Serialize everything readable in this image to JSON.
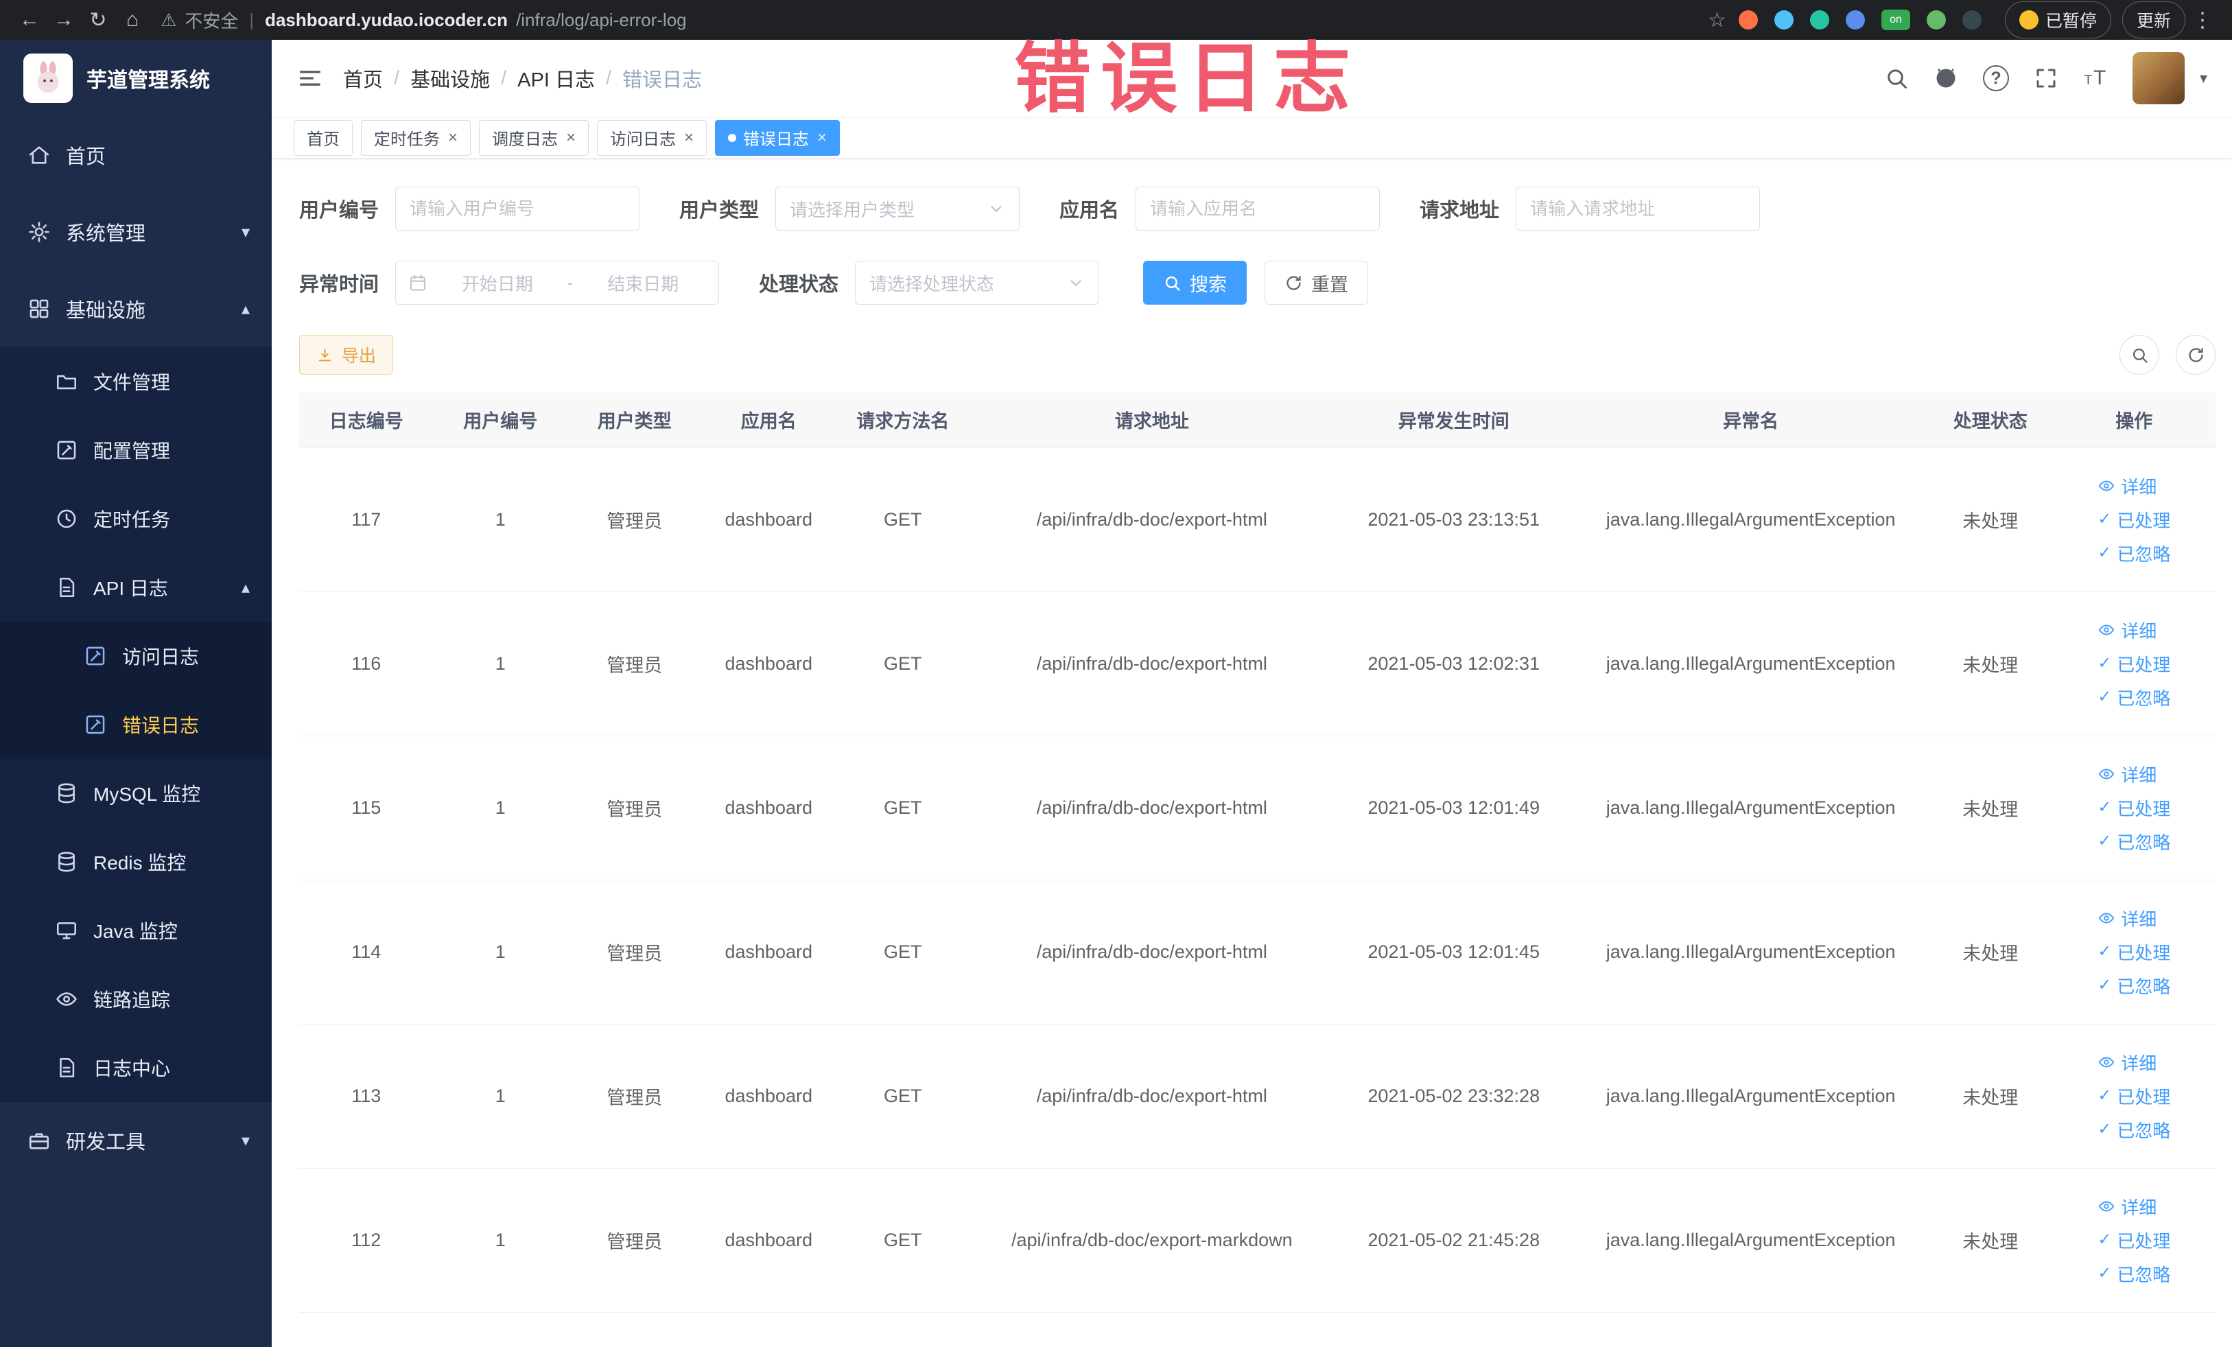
{
  "browser": {
    "security_label": "不安全",
    "url_host": "dashboard.yudao.iocoder.cn",
    "url_path": "/infra/log/api-error-log",
    "on_badge": "on",
    "paused_label": "已暂停",
    "update_label": "更新"
  },
  "annotation": {
    "text": "错误日志"
  },
  "sidebar": {
    "title": "芋道管理系统",
    "items": [
      {
        "id": "home",
        "label": "首页",
        "icon": "home-icon",
        "level": 0
      },
      {
        "id": "system-management",
        "label": "系统管理",
        "icon": "gear-icon",
        "level": 0,
        "chevron": "down"
      },
      {
        "id": "infrastructure",
        "label": "基础设施",
        "icon": "grid-icon",
        "level": 0,
        "chevron": "up"
      },
      {
        "id": "file-management",
        "label": "文件管理",
        "icon": "folder-icon",
        "level": 1
      },
      {
        "id": "config-management",
        "label": "配置管理",
        "icon": "edit-icon",
        "level": 1
      },
      {
        "id": "scheduled-tasks",
        "label": "定时任务",
        "icon": "clock-icon",
        "level": 1
      },
      {
        "id": "api-logs",
        "label": "API 日志",
        "icon": "doc-icon",
        "level": 1,
        "chevron": "up"
      },
      {
        "id": "access-logs",
        "label": "访问日志",
        "icon": "edit-icon",
        "level": 2
      },
      {
        "id": "error-logs",
        "label": "错误日志",
        "icon": "edit-icon",
        "level": 2,
        "active": true
      },
      {
        "id": "mysql-monitor",
        "label": "MySQL 监控",
        "icon": "database-icon",
        "level": 1
      },
      {
        "id": "redis-monitor",
        "label": "Redis 监控",
        "icon": "database-icon",
        "level": 1
      },
      {
        "id": "java-monitor",
        "label": "Java 监控",
        "icon": "monitor-icon",
        "level": 1
      },
      {
        "id": "tracing",
        "label": "链路追踪",
        "icon": "eye-icon",
        "level": 1
      },
      {
        "id": "log-center",
        "label": "日志中心",
        "icon": "doc-icon",
        "level": 1
      },
      {
        "id": "dev-tools",
        "label": "研发工具",
        "icon": "briefcase-icon",
        "level": 0,
        "chevron": "down"
      }
    ]
  },
  "header": {
    "breadcrumb": [
      "首页",
      "基础设施",
      "API 日志",
      "错误日志"
    ]
  },
  "tabs": [
    {
      "label": "首页",
      "closable": false,
      "active": false
    },
    {
      "label": "定时任务",
      "closable": true,
      "active": false
    },
    {
      "label": "调度日志",
      "closable": true,
      "active": false
    },
    {
      "label": "访问日志",
      "closable": true,
      "active": false
    },
    {
      "label": "错误日志",
      "closable": true,
      "active": true
    }
  ],
  "filters": {
    "user_id": {
      "label": "用户编号",
      "placeholder": "请输入用户编号"
    },
    "user_type": {
      "label": "用户类型",
      "placeholder": "请选择用户类型"
    },
    "app_name": {
      "label": "应用名",
      "placeholder": "请输入应用名"
    },
    "request_url": {
      "label": "请求地址",
      "placeholder": "请输入请求地址"
    },
    "exception_time": {
      "label": "异常时间",
      "start_placeholder": "开始日期",
      "separator": "-",
      "end_placeholder": "结束日期"
    },
    "process_status": {
      "label": "处理状态",
      "placeholder": "请选择处理状态"
    },
    "search_label": "搜索",
    "reset_label": "重置"
  },
  "toolbar": {
    "export_label": "导出"
  },
  "table": {
    "columns": [
      "日志编号",
      "用户编号",
      "用户类型",
      "应用名",
      "请求方法名",
      "请求地址",
      "异常发生时间",
      "异常名",
      "处理状态",
      "操作"
    ],
    "rows": [
      [
        "117",
        "1",
        "管理员",
        "dashboard",
        "GET",
        "/api/infra/db-doc/export-html",
        "2021-05-03 23:13:51",
        "java.lang.IllegalArgumentException",
        "未处理"
      ],
      [
        "116",
        "1",
        "管理员",
        "dashboard",
        "GET",
        "/api/infra/db-doc/export-html",
        "2021-05-03 12:02:31",
        "java.lang.IllegalArgumentException",
        "未处理"
      ],
      [
        "115",
        "1",
        "管理员",
        "dashboard",
        "GET",
        "/api/infra/db-doc/export-html",
        "2021-05-03 12:01:49",
        "java.lang.IllegalArgumentException",
        "未处理"
      ],
      [
        "114",
        "1",
        "管理员",
        "dashboard",
        "GET",
        "/api/infra/db-doc/export-html",
        "2021-05-03 12:01:45",
        "java.lang.IllegalArgumentException",
        "未处理"
      ],
      [
        "113",
        "1",
        "管理员",
        "dashboard",
        "GET",
        "/api/infra/db-doc/export-html",
        "2021-05-02 23:32:28",
        "java.lang.IllegalArgumentException",
        "未处理"
      ],
      [
        "112",
        "1",
        "管理员",
        "dashboard",
        "GET",
        "/api/infra/db-doc/export-markdown",
        "2021-05-02 21:45:28",
        "java.lang.IllegalArgumentException",
        "未处理"
      ]
    ],
    "actions": [
      {
        "name": "detail",
        "icon": "eye-icon",
        "label": "详细"
      },
      {
        "name": "processed",
        "icon": "check-icon",
        "label": "已处理"
      },
      {
        "name": "ignored",
        "icon": "check-icon",
        "label": "已忽略"
      }
    ]
  },
  "colors": {
    "accent": "#409eff",
    "warning_text": "#e6a23c",
    "sidebar_bg": "#1e2c4a",
    "sidebar_active_text": "#ffd04b",
    "tab_active_bg": "#409eff",
    "annotation": "#ee4c60"
  }
}
